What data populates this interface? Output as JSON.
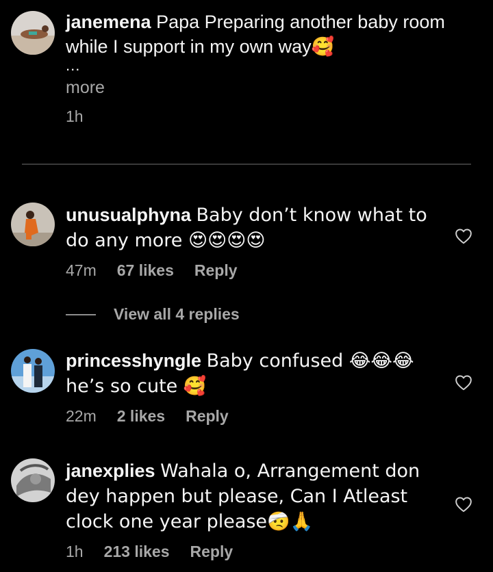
{
  "comments": [
    {
      "username": "janemena",
      "text": "Papa Preparing another baby room while I support in my own way🥰",
      "ellipsis": "...",
      "more_label": "more",
      "time": "1h"
    },
    {
      "username": "unusualphyna",
      "text": "Baby don’t know what to do any more 😍😍😍😍",
      "time": "47m",
      "likes": "67 likes",
      "reply_label": "Reply"
    },
    {
      "username": "princesshyngle",
      "text": "Baby confused 😂😂😂 he’s so cute 🥰",
      "time": "22m",
      "likes": "2 likes",
      "reply_label": "Reply"
    },
    {
      "username": "janexplies",
      "text": "Wahala o, Arrangement don dey happen but please, Can I Atleast clock one year please🤕🙏",
      "time": "1h",
      "likes": "213 likes",
      "reply_label": "Reply"
    }
  ],
  "view_replies_label": "View all 4 replies",
  "colors": {
    "background": "#000000",
    "text": "#f5f5f5",
    "secondary_text": "#a8a8a8",
    "divider": "#3a3a3a"
  },
  "icons": [
    "heart-icon"
  ]
}
